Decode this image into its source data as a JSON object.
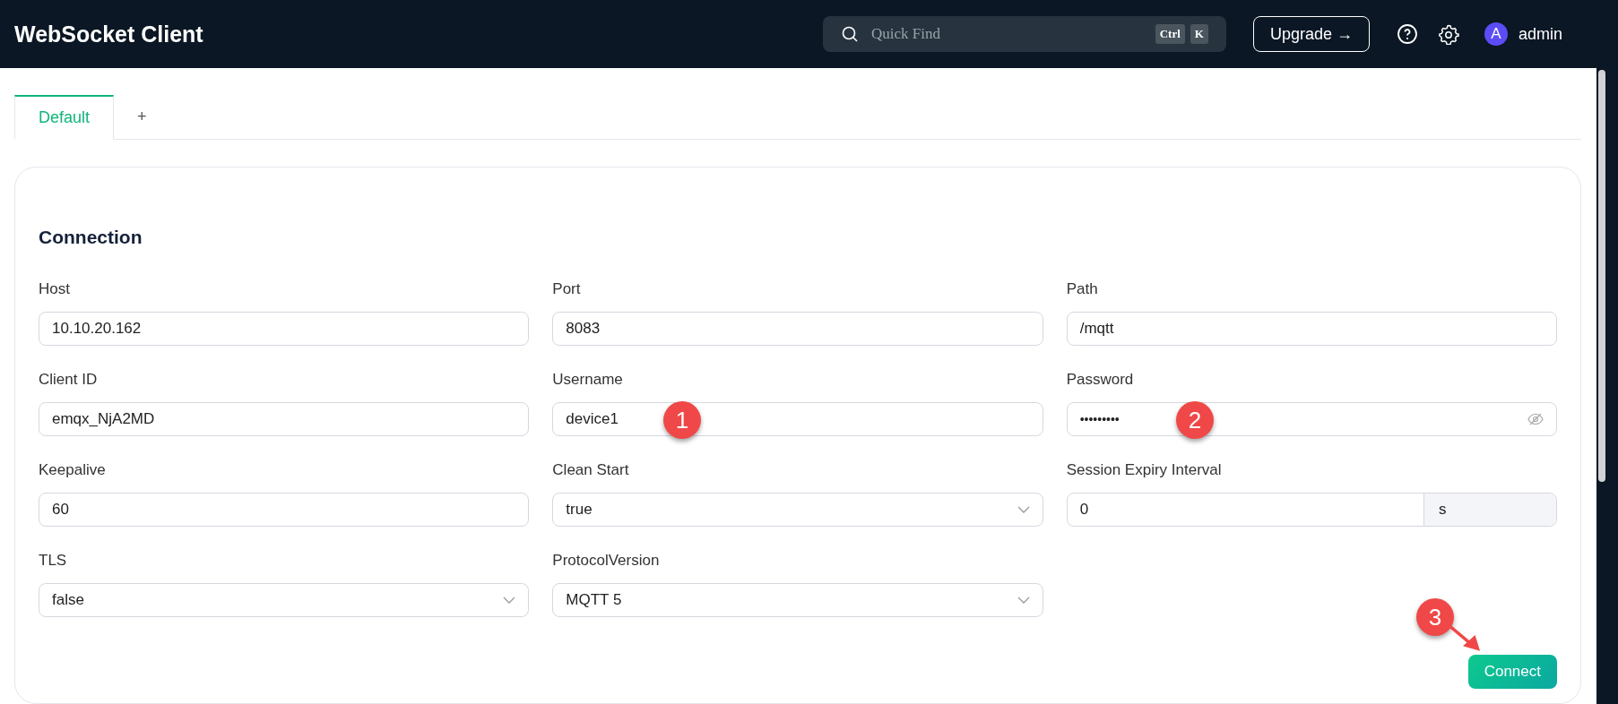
{
  "header": {
    "title": "WebSocket Client",
    "search": {
      "placeholder": "Quick Find",
      "keys": [
        "Ctrl",
        "K"
      ]
    },
    "upgrade": "Upgrade →",
    "user": {
      "initial": "A",
      "name": "admin"
    }
  },
  "tabs": [
    {
      "label": "Default",
      "selected": true
    },
    {
      "label": "+",
      "selected": false
    }
  ],
  "section": {
    "title": "Connection"
  },
  "fields": [
    {
      "label": "Host",
      "kind": "text",
      "value": "10.10.20.162"
    },
    {
      "label": "Port",
      "kind": "text",
      "value": "8083"
    },
    {
      "label": "Path",
      "kind": "text",
      "value": "/mqtt"
    },
    {
      "label": "Client ID",
      "kind": "text",
      "value": "emqx_NjA2MD"
    },
    {
      "label": "Username",
      "kind": "text",
      "value": "device1"
    },
    {
      "label": "Password",
      "kind": "password",
      "value": "•••••••••"
    },
    {
      "label": "Keepalive",
      "kind": "text",
      "value": "60"
    },
    {
      "label": "Clean Start",
      "kind": "select",
      "value": "true"
    },
    {
      "label": "Session Expiry Interval",
      "kind": "unit",
      "value": "0",
      "unit": "s"
    },
    {
      "label": "TLS",
      "kind": "select",
      "value": "false"
    },
    {
      "label": "ProtocolVersion",
      "kind": "select",
      "value": "MQTT 5"
    }
  ],
  "connect_button": "Connect",
  "annotations": [
    "1",
    "2",
    "3"
  ]
}
